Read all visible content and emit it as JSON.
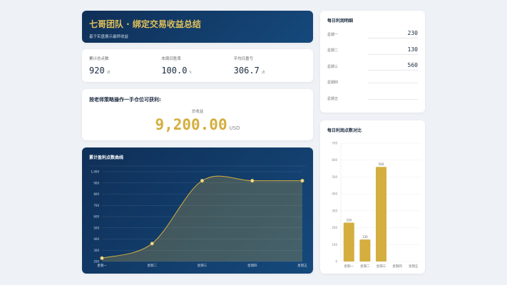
{
  "header": {
    "title": "七哥团队 · 绑定交易收益总结",
    "subtitle": "基于实盘展示最终收益"
  },
  "stats": [
    {
      "label": "累计总点数",
      "value": "920",
      "unit": "点"
    },
    {
      "label": "本周日胜率",
      "value": "100.0",
      "unit": "%"
    },
    {
      "label": "平均日盈亏",
      "value": "306.7",
      "unit": "点"
    }
  ],
  "total": {
    "heading": "按老师策略操作一手仓位可获利:",
    "label": "总收益",
    "value": "9,200.00",
    "unit": "USD"
  },
  "daily": {
    "title": "每日利润明细",
    "rows": [
      {
        "day": "星期一",
        "value": "230"
      },
      {
        "day": "星期二",
        "value": "130"
      },
      {
        "day": "星期三",
        "value": "560"
      },
      {
        "day": "星期四",
        "value": ""
      },
      {
        "day": "星期五",
        "value": ""
      }
    ]
  },
  "colors": {
    "accent": "#d4ae3e",
    "dark": "#12406f"
  },
  "chart_data": [
    {
      "type": "line",
      "title": "累计盈利点数曲线",
      "categories": [
        "星期一",
        "星期二",
        "星期三",
        "星期四",
        "星期五"
      ],
      "values": [
        230,
        360,
        920,
        920,
        920
      ],
      "ylim": [
        200,
        1000
      ],
      "yticks": [
        "200",
        "300",
        "400",
        "500",
        "600",
        "700",
        "800",
        "900",
        "1,000"
      ],
      "grid": true,
      "smooth": true,
      "area": true
    },
    {
      "type": "bar",
      "title": "每日利润点数对比",
      "categories": [
        "星期一",
        "星期二",
        "星期三",
        "星期四",
        "星期五"
      ],
      "values": [
        230,
        130,
        560,
        null,
        null
      ],
      "data_labels": [
        "230",
        "130",
        "560"
      ],
      "ylim": [
        0,
        700
      ],
      "yticks": [
        "0",
        "100",
        "200",
        "300",
        "400",
        "500",
        "600",
        "700"
      ],
      "grid": true
    }
  ]
}
